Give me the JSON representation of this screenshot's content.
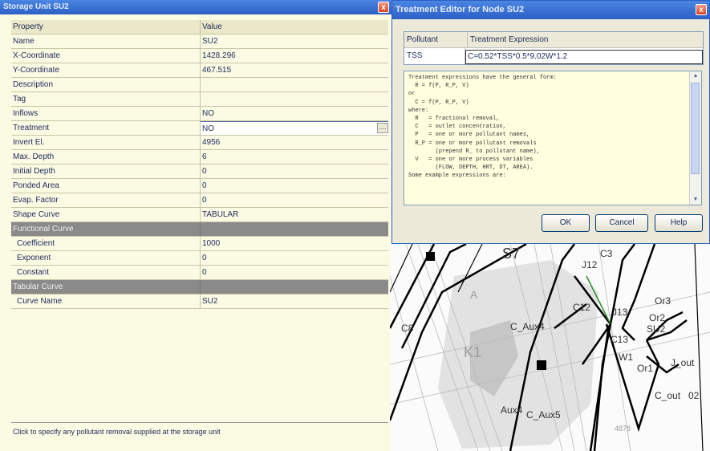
{
  "property_editor": {
    "title": "Storage Unit SU2",
    "columns": [
      "Property",
      "Value"
    ],
    "rows": [
      {
        "name": "Name",
        "value": "SU2"
      },
      {
        "name": "X-Coordinate",
        "value": "1428.296"
      },
      {
        "name": "Y-Coordinate",
        "value": "467.515"
      },
      {
        "name": "Description",
        "value": ""
      },
      {
        "name": "Tag",
        "value": ""
      },
      {
        "name": "Inflows",
        "value": "NO"
      },
      {
        "name": "Treatment",
        "value": "NO"
      },
      {
        "name": "Invert El.",
        "value": "4956"
      },
      {
        "name": "Max. Depth",
        "value": "6"
      },
      {
        "name": "Initial Depth",
        "value": "0"
      },
      {
        "name": "Ponded Area",
        "value": "0"
      },
      {
        "name": "Evap. Factor",
        "value": "0"
      },
      {
        "name": "Shape Curve",
        "value": "TABULAR"
      }
    ],
    "functional_section": "Functional Curve",
    "functional_rows": [
      {
        "name": "Coefficient",
        "value": "1000"
      },
      {
        "name": "Exponent",
        "value": "0"
      },
      {
        "name": "Constant",
        "value": "0"
      }
    ],
    "tabular_section": "Tabular Curve",
    "tabular_rows": [
      {
        "name": "Curve Name",
        "value": "SU2"
      }
    ],
    "description": "Click to specify any pollutant removal supplied at the storage unit",
    "close_glyph": "x",
    "ellipsis": "...."
  },
  "treatment_editor": {
    "title": "Treatment Editor for Node SU2",
    "col_pollutant": "Pollutant",
    "col_expression": "Treatment Expression",
    "pollutant": "TSS",
    "expression": "C=0.52*TSS*0.5*9.02W*1.2",
    "help_text": "Treatment expressions have the general form:\n  R = f(P, R_P, V)\nor\n  C = f(P, R_P, V)\nwhere:\n  R   = fractional removal,\n  C   = outlet concentration,\n  P   = one or more pollutant names,\n  R_P = one or more pollutant removals\n        (prepend R_ to pollutant name),\n  V   = one or more process variables\n        (FLOW, DEPTH, HRT, DT, AREA).\nSome example expressions are:",
    "ok_label": "OK",
    "cancel_label": "Cancel",
    "help_label": "Help",
    "scroll_up": "▲",
    "scroll_down": "▼",
    "close_glyph": "x"
  },
  "map": {
    "labels": {
      "s7": "S7",
      "c3": "C3",
      "j12": "J12",
      "or3": "Or3",
      "or2": "Or2",
      "su2": "SU2",
      "c12": "C12",
      "j13": "J13",
      "c8": "C8",
      "c_aux4": "C_Aux4",
      "c13": "C13",
      "w1": "W1",
      "or1": "Or1",
      "j_out": "J_out",
      "c_out": "C_out",
      "o2": "02",
      "aux4": "Aux4",
      "c_aux5": "C_Aux5",
      "k1": "K1",
      "n4878": "4878",
      "a": "A"
    }
  }
}
